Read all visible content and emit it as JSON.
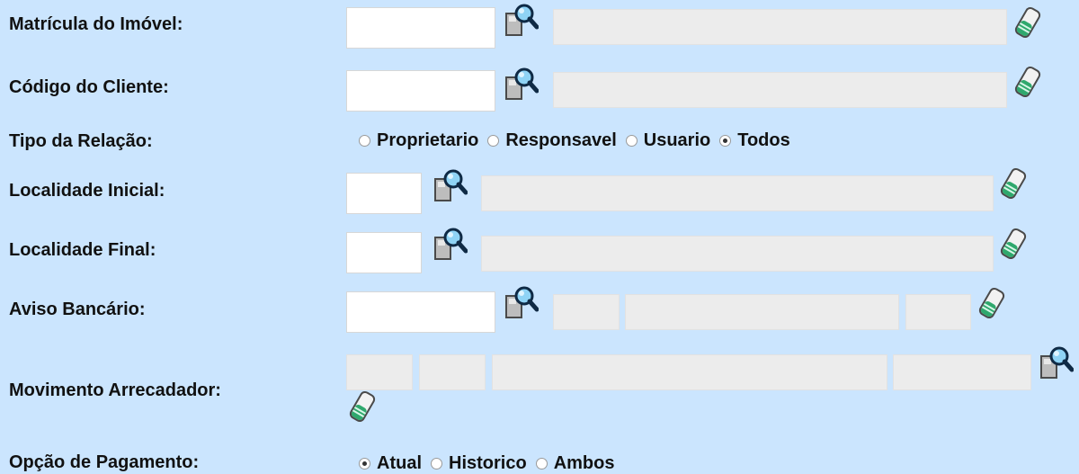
{
  "form": {
    "matricula": {
      "label": "Matrícula do Imóvel:"
    },
    "codigo_cliente": {
      "label": "Código do Cliente:"
    },
    "tipo_relacao": {
      "label": "Tipo da Relação:",
      "options": [
        "Proprietario",
        "Responsavel",
        "Usuario",
        "Todos"
      ],
      "selected": "Todos"
    },
    "localidade_inicial": {
      "label": "Localidade Inicial:"
    },
    "localidade_final": {
      "label": "Localidade Final:"
    },
    "aviso_bancario": {
      "label": "Aviso Bancário:"
    },
    "movimento_arrecadador": {
      "label": "Movimento Arrecadador:"
    },
    "opcao_pagamento": {
      "label": "Opção de Pagamento:",
      "options": [
        "Atual",
        "Historico",
        "Ambos"
      ],
      "selected": "Atual"
    }
  },
  "icons": {
    "search": "magnifier-search-icon",
    "clear": "eraser-clear-icon"
  },
  "colors": {
    "background": "#cbe5fe",
    "input_bg": "#ffffff",
    "readonly_bg": "#ececec"
  }
}
